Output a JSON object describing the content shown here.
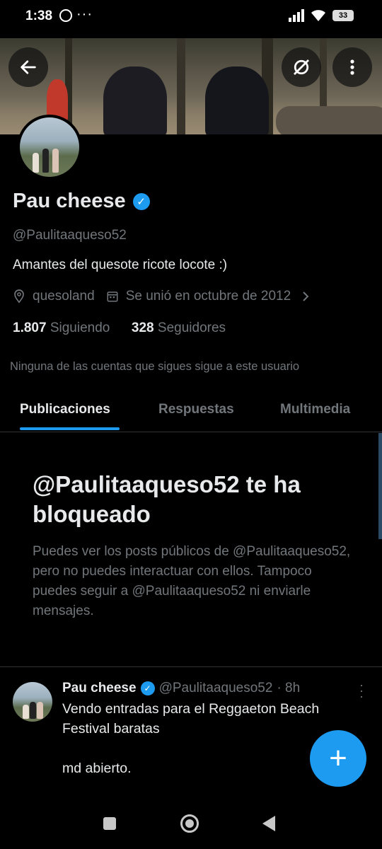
{
  "status_bar": {
    "time": "1:38",
    "dots": "···",
    "battery": "33"
  },
  "header": {
    "back_icon": "arrow-left-icon",
    "hide_icon": "slash-circle-icon",
    "more_icon": "more-vertical-icon"
  },
  "profile": {
    "name": "Pau cheese",
    "handle": "@Paulitaaqueso52",
    "bio": "Amantes del quesote ricote locote :)",
    "location": "quesoland",
    "joined": "Se unió en octubre de 2012",
    "following_count": "1.807",
    "following_label": "Siguiendo",
    "followers_count": "328",
    "followers_label": "Seguidores",
    "notice": "Ninguna de las cuentas que sigues sigue a este usuario"
  },
  "tabs": [
    {
      "label": "Publicaciones",
      "active": true
    },
    {
      "label": "Respuestas",
      "active": false
    },
    {
      "label": "Multimedia",
      "active": false
    }
  ],
  "blocked": {
    "title": "@Paulitaaqueso52 te ha bloqueado",
    "text": "Puedes ver los posts públicos de @Paulitaaqueso52, pero no puedes interactuar con ellos. Tampoco puedes seguir a @Paulitaaqueso52 ni enviarle mensajes."
  },
  "tweet": {
    "name": "Pau cheese",
    "handle": "@Paulitaaqueso52",
    "time": "· 8h",
    "line1": "Vendo entradas para el Reggaeton Beach Festival baratas",
    "line2": "md abierto."
  },
  "fab_label": "+",
  "colors": {
    "accent": "#1d9bf0",
    "secondary_text": "#71767b",
    "background": "#000000"
  }
}
